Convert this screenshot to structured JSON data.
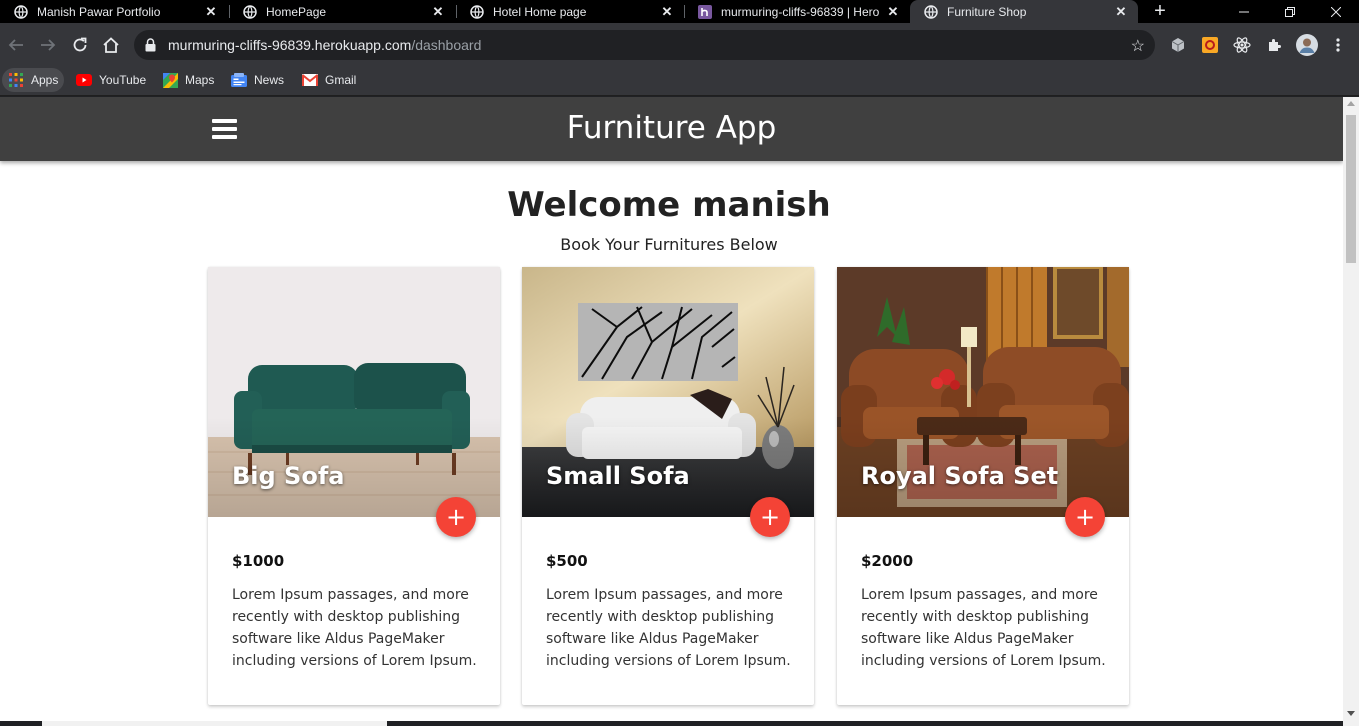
{
  "browser": {
    "tabs": [
      {
        "title": "Manish Pawar Portfolio",
        "icon": "globe-icon",
        "active": false
      },
      {
        "title": "HomePage",
        "icon": "globe-icon",
        "active": false
      },
      {
        "title": "Hotel Home page",
        "icon": "globe-icon",
        "active": false
      },
      {
        "title": "murmuring-cliffs-96839 | Hero",
        "icon": "heroku-icon",
        "active": false
      },
      {
        "title": "Furniture Shop",
        "icon": "globe-icon",
        "active": true
      }
    ],
    "url_host": "murmuring-cliffs-96839.herokuapp.com",
    "url_path": "/dashboard",
    "bookmarks": [
      {
        "label": "Apps",
        "icon": "apps-grid-icon"
      },
      {
        "label": "YouTube",
        "icon": "youtube-icon"
      },
      {
        "label": "Maps",
        "icon": "maps-icon"
      },
      {
        "label": "News",
        "icon": "news-icon"
      },
      {
        "label": "Gmail",
        "icon": "gmail-icon"
      }
    ]
  },
  "app": {
    "title": "Furniture App",
    "welcome": "Welcome manish",
    "subtitle": "Book Your Furnitures Below",
    "add_label": "+",
    "accent_color": "#f44336",
    "appbar_color": "#404040"
  },
  "products": [
    {
      "title": "Big Sofa",
      "price": "$1000",
      "description": "Lorem Ipsum passages, and more recently with desktop publishing software like Aldus PageMaker including versions of Lorem Ipsum."
    },
    {
      "title": "Small Sofa",
      "price": "$500",
      "description": "Lorem Ipsum passages, and more recently with desktop publishing software like Aldus PageMaker including versions of Lorem Ipsum."
    },
    {
      "title": "Royal Sofa Set",
      "price": "$2000",
      "description": "Lorem Ipsum passages, and more recently with desktop publishing software like Aldus PageMaker including versions of Lorem Ipsum."
    }
  ]
}
